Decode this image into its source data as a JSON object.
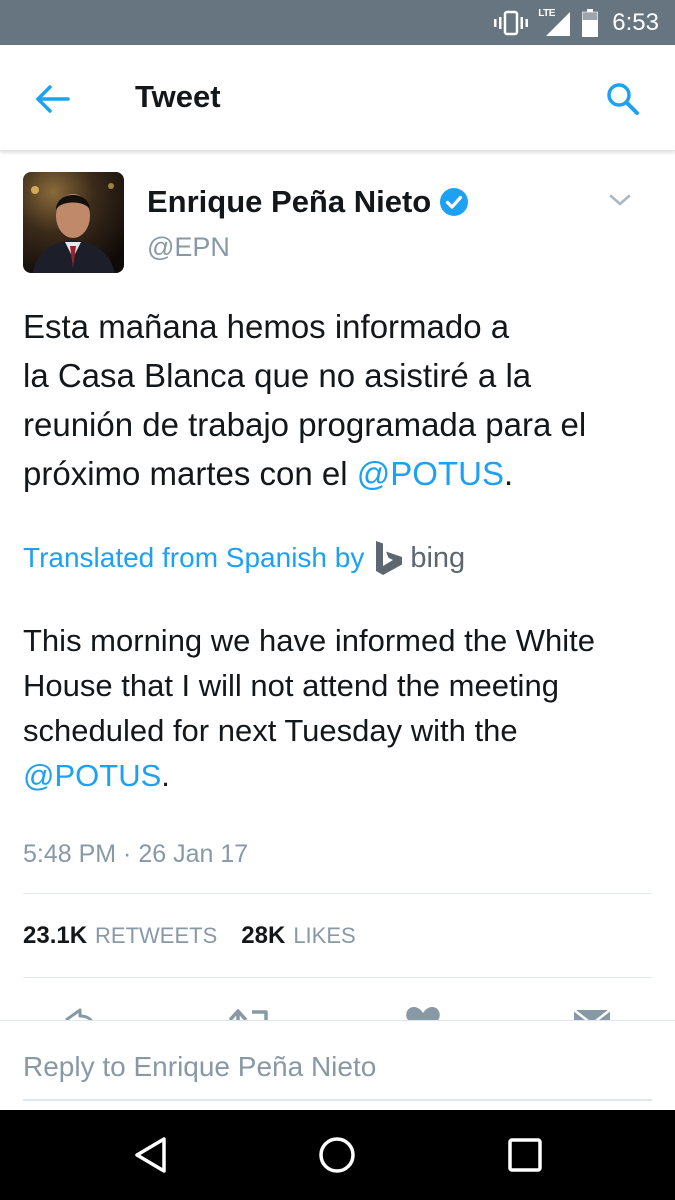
{
  "status_bar": {
    "time": "6:53",
    "network": "LTE",
    "icons": [
      "vibrate-icon",
      "lte-signal-icon",
      "battery-icon"
    ]
  },
  "app_bar": {
    "title": "Tweet",
    "back_icon": "back-arrow-icon",
    "search_icon": "search-icon",
    "accent_color": "#1da1f2"
  },
  "tweet": {
    "author": {
      "name": "Enrique Peña Nieto",
      "handle": "@EPN",
      "verified": true
    },
    "text_lines": [
      {
        "text": "Esta mañana hemos informado a",
        "mention": ""
      },
      {
        "text": "la Casa Blanca que no asistiré a la",
        "mention": ""
      },
      {
        "text": "reunión de trabajo programada para el",
        "mention": ""
      },
      {
        "text": "próximo martes con el ",
        "mention": "@POTUS",
        "after": "."
      }
    ],
    "translation_notice": "Translated from Spanish by",
    "translator": "bing",
    "translation_lines": [
      {
        "text": "This morning we have informed the White",
        "mention": ""
      },
      {
        "text": "House that I will not attend the meeting",
        "mention": ""
      },
      {
        "text": "scheduled for next Tuesday with the",
        "mention": ""
      },
      {
        "text": "",
        "mention": "@POTUS",
        "after": "."
      }
    ],
    "timestamp": "5:48 PM · 26 Jan 17",
    "stats": {
      "retweets_count": "23.1K",
      "retweets_label": "RETWEETS",
      "likes_count": "28K",
      "likes_label": "LIKES"
    }
  },
  "reply": {
    "placeholder": "Reply to Enrique Peña Nieto"
  },
  "nav_bar": {
    "icons": [
      "nav-back-icon",
      "nav-home-icon",
      "nav-recents-icon"
    ]
  }
}
